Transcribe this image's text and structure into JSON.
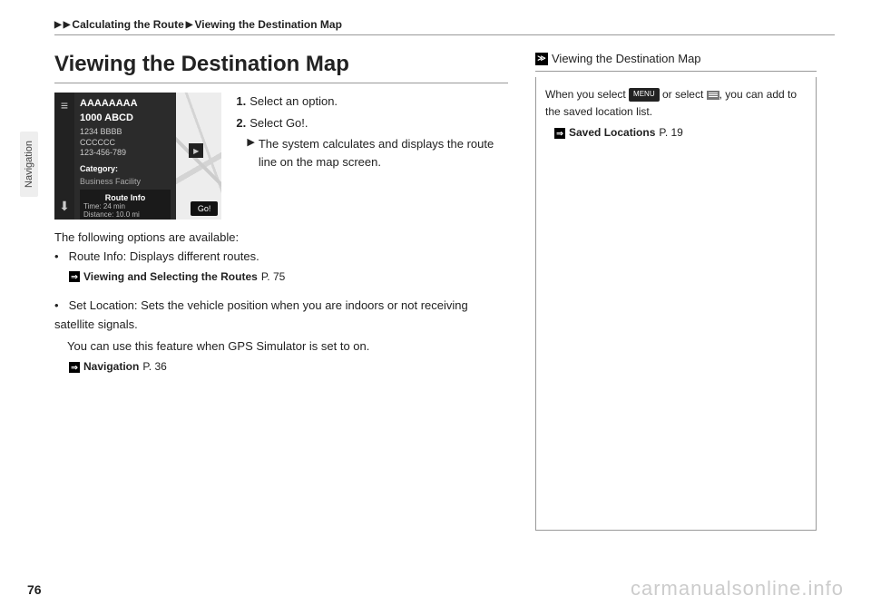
{
  "breadcrumb": {
    "part1": "Calculating the Route",
    "part2": "Viewing the Destination Map"
  },
  "sideTab": "Navigation",
  "title": "Viewing the Destination Map",
  "screenshot": {
    "name": "AAAAAAAA",
    "addr": "1000 ABCD",
    "line1": "1234 BBBB",
    "line2": "CCCCCC",
    "line3": "123-456-789",
    "catLabel": "Category:",
    "catValue": "Business Facility",
    "routeTitle": "Route Info",
    "routeTime": "Time: 24 min",
    "routeDist": "Distance: 10.0 mi",
    "goBtn": "Go!"
  },
  "steps": {
    "s1num": "1.",
    "s1text": "Select an option.",
    "s2num": "2.",
    "s2text_a": "Select ",
    "s2text_b": "Go!",
    "s2text_c": ".",
    "sub": "The system calculates and displays the route line on the map screen."
  },
  "body": {
    "intro": "The following options are available:",
    "opt1_label": "Route Info",
    "opt1_text": ": Displays different routes.",
    "opt1_link": "Viewing and Selecting the Routes",
    "opt1_page": "P. 75",
    "opt2_label": "Set Location",
    "opt2_text": ": Sets the vehicle position when you are indoors or not receiving satellite signals.",
    "opt2_extra": "You can use this feature when GPS Simulator is set to on.",
    "opt2_link": "Navigation",
    "opt2_page": "P. 36"
  },
  "sidebar": {
    "title": "Viewing the Destination Map",
    "text_a": "When you select ",
    "menuLabel": "MENU",
    "text_b": " or select ",
    "text_c": ", you can add to the saved location list.",
    "link": "Saved Locations",
    "linkPage": "P. 19"
  },
  "pageNum": "76",
  "watermark": "carmanualsonline.info"
}
